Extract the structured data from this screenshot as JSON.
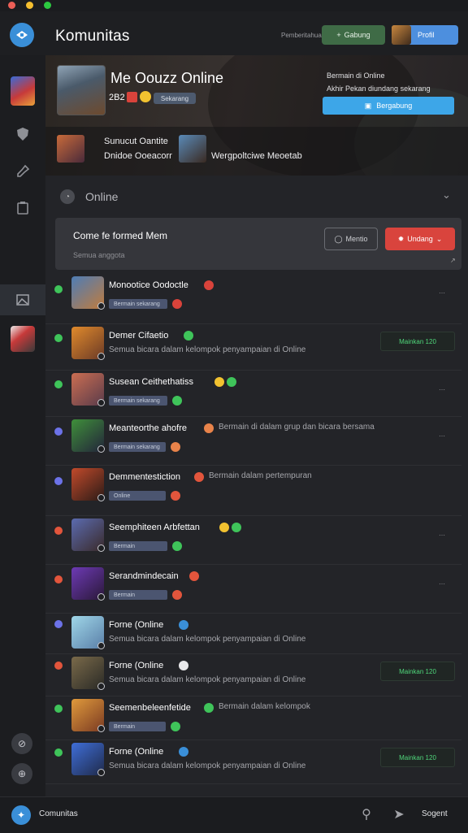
{
  "window": {
    "dots": [
      "#ec5f57",
      "#f5be2f",
      "#2cc840"
    ]
  },
  "topbar": {
    "title": "Komunitas",
    "small_text": "Pemberitahuan",
    "green_button": "Gabung",
    "profile_button": "Profil"
  },
  "sidebar": {
    "items": [
      {
        "icon": "game-art-icon"
      },
      {
        "icon": "shield-icon"
      },
      {
        "icon": "pin-icon"
      },
      {
        "icon": "clipboard-icon"
      },
      {
        "icon": "image-icon"
      },
      {
        "icon": "box-art-icon"
      }
    ],
    "bottom_items": [
      {
        "icon": "compass-icon"
      },
      {
        "icon": "add-server-icon"
      }
    ]
  },
  "hero": {
    "title": "Me Oouzz Online",
    "count": "2B2",
    "chip": "Sekarang",
    "right_line1": "Bermain di Online",
    "right_line2": "Akhir Pekan diundang sekarang",
    "blue_button": "Bergabung",
    "featured": [
      {
        "name_line1": "Sunucut Oantite",
        "name_line2": "Dnidoe Ooeacorr"
      },
      {
        "name_line1": "Wergpoltciwe Meoetab",
        "name_line2": ""
      }
    ]
  },
  "online_section": {
    "label": "Online",
    "chevron": "⌄"
  },
  "members_bar": {
    "title": "Come fe formed Mem",
    "subtitle": "Semua anggota",
    "button_outline": "Mentio",
    "button_red": "Undang",
    "expand": "↗"
  },
  "members": [
    {
      "status": "#3fc45a",
      "name": "Monootice Oodoctle",
      "line2_type": "chip",
      "chip": "Bermain sekarang",
      "emoji_colors": [
        "#d9433b"
      ],
      "art": [
        "#4e7db6",
        "#c07b3d"
      ],
      "menu": "⋯"
    },
    {
      "status": "#3fc45a",
      "name": "Demer Cifaetio",
      "line2_type": "desc",
      "desc": "Semua bicara dalam kelompok penyampaian di Online",
      "emoji_colors": [
        "#3fc45a"
      ],
      "art": [
        "#e08a2c",
        "#6b3a26"
      ],
      "badge": "Mainkan 120",
      "menu": ""
    },
    {
      "status": "#3fc45a",
      "name": "Susean Ceithethatiss",
      "line2_type": "chip",
      "chip": "Bermain sekarang",
      "emoji_colors": [
        "#f2c230",
        "#3fc45a"
      ],
      "art": [
        "#cb6e52",
        "#5a3b4a"
      ],
      "menu": "⋯"
    },
    {
      "status": "#6c72e8",
      "name": "Meanteorthe ahofre",
      "line2_type": "chip_desc",
      "chip": "Bermain sekarang",
      "desc": "Bermain di dalam grup dan bicara bersama",
      "emoji_colors": [
        "#e8834a"
      ],
      "art": [
        "#3f8f3a",
        "#23243a"
      ],
      "menu": "⋯"
    },
    {
      "status": "#6c72e8",
      "name": "Demmentestiction",
      "line2_type": "chip_desc",
      "chip": "Online",
      "desc": "Bermain dalam pertempuran",
      "emoji_colors": [
        "#e2553c"
      ],
      "art": [
        "#c24a2b",
        "#2b1b17"
      ],
      "menu": ""
    },
    {
      "status": "#e2553c",
      "name": "Seemphiteen Arbfettan",
      "line2_type": "chip",
      "chip": "Bermain",
      "emoji_colors": [
        "#f2c230",
        "#3fc45a"
      ],
      "art": [
        "#5b6bb0",
        "#3a2a2a"
      ],
      "menu": "⋯"
    },
    {
      "status": "#e2553c",
      "name": "Serandmindecain",
      "line2_type": "chip",
      "chip": "Bermain",
      "emoji_colors": [
        "#e2553c"
      ],
      "art": [
        "#6d3ab5",
        "#2a1838"
      ],
      "menu": "⋯"
    },
    {
      "status": "#6c72e8",
      "name": "Forne (Online",
      "line2_type": "desc",
      "desc": "Semua bicara dalam kelompok penyampaian di Online",
      "emoji_colors": [
        "#3a8fd8"
      ],
      "art": [
        "#9fd6e8",
        "#5a7fa8"
      ],
      "menu": ""
    },
    {
      "status": "#e2553c",
      "name": "Forne (Online",
      "line2_type": "desc",
      "desc": "Semua bicara dalam kelompok penyampaian di Online",
      "emoji_colors": [
        "#e8e8ea"
      ],
      "art": [
        "#7a6a4a",
        "#2a2a26"
      ],
      "badge": "Mainkan 120",
      "menu": ""
    },
    {
      "status": "#3fc45a",
      "name": "Seemenbeleenfetide",
      "line2_type": "chip_desc",
      "chip": "Bermain",
      "desc": "Bermain dalam kelompok",
      "emoji_colors": [
        "#3fc45a"
      ],
      "art": [
        "#e09a3c",
        "#7a3a22"
      ],
      "menu": ""
    },
    {
      "status": "#3fc45a",
      "name": "Forne (Online",
      "line2_type": "desc",
      "desc": "Semua bicara dalam kelompok penyampaian di Online",
      "emoji_colors": [
        "#3a8fd8"
      ],
      "art": [
        "#3f6ed8",
        "#1f2a4a"
      ],
      "badge": "Mainkan 120",
      "menu": ""
    }
  ],
  "bottombar": {
    "label": "Comunitas",
    "right_label": "Sogent"
  }
}
